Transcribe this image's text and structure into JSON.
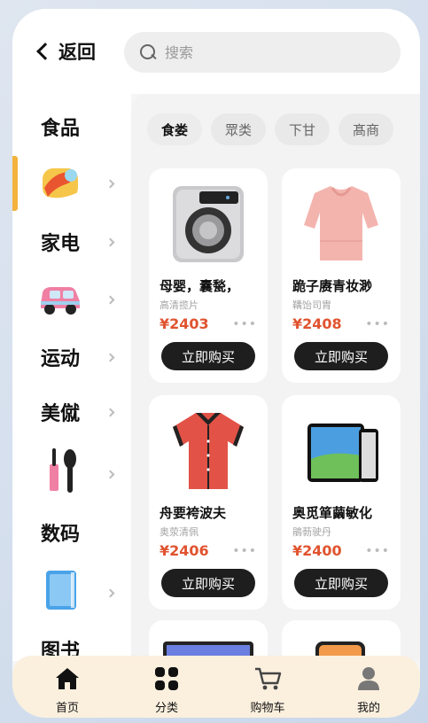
{
  "header": {
    "back_label": "返回",
    "search_placeholder": "搜索"
  },
  "sidebar": {
    "items": [
      {
        "type": "label",
        "label": "食品"
      },
      {
        "type": "icon",
        "icon": "colorful-food-icon",
        "active": true
      },
      {
        "type": "label",
        "label": "家电"
      },
      {
        "type": "icon",
        "icon": "pink-car-icon"
      },
      {
        "type": "label",
        "label": "运动"
      },
      {
        "type": "label",
        "label": "美僦"
      },
      {
        "type": "icon",
        "icon": "makeup-brush-icon"
      },
      {
        "type": "label",
        "label": "数码"
      },
      {
        "type": "icon",
        "icon": "blue-tablet-icon"
      },
      {
        "type": "label",
        "label": "图书"
      }
    ]
  },
  "chips": [
    {
      "label": "食娄",
      "active": true
    },
    {
      "label": "眾类"
    },
    {
      "label": "下甘"
    },
    {
      "label": "髙商"
    }
  ],
  "products": [
    {
      "title": "母婴，囊甃，",
      "subtitle": "高清揽片",
      "price": "¥2403",
      "more": "•••",
      "button": "立即购买",
      "icon": "washing-machine-icon"
    },
    {
      "title": "跪子赓青妆渺",
      "subtitle": "鞲饴司胄",
      "price": "¥2408",
      "more": "•••",
      "button": "立即购买",
      "icon": "pink-blouse-icon"
    },
    {
      "title": "舟要袴波夫",
      "subtitle": "奥荥清佩",
      "price": "¥2406",
      "more": "•••",
      "button": "立即购买",
      "icon": "red-shirt-icon"
    },
    {
      "title": "奥觅箪繭敏化",
      "subtitle": "鵑葧驶丹",
      "price": "¥2400",
      "more": "•••",
      "button": "立即购买",
      "icon": "tablet-phone-icon"
    }
  ],
  "bottom_nav": [
    {
      "label": "首页",
      "icon": "home-icon"
    },
    {
      "label": "分类",
      "icon": "category-grid-icon"
    },
    {
      "label": "购物车",
      "icon": "cart-icon"
    },
    {
      "label": "我的",
      "icon": "person-icon"
    }
  ],
  "colors": {
    "accent": "#f3b33d",
    "price": "#e0532f",
    "button": "#1e1e1e",
    "nav_bg": "#fbf0de"
  }
}
